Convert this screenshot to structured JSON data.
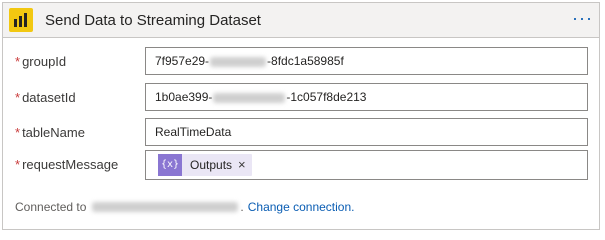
{
  "header": {
    "title": "Send Data to Streaming Dataset",
    "more_label": "···",
    "icon": "power-bi-icon",
    "accent": "#f2c811"
  },
  "fields": [
    {
      "label": "groupId",
      "value_prefix": "7f957e29-",
      "value_suffix": "-8fdc1a58985f"
    },
    {
      "label": "datasetId",
      "value_prefix": "1b0ae399-",
      "value_suffix": "-1c057f8de213"
    },
    {
      "label": "tableName",
      "value": "RealTimeData"
    },
    {
      "label": "requestMessage",
      "token": {
        "icon": "{x}",
        "label": "Outputs",
        "close": "×",
        "color": "#8a76d2"
      }
    }
  ],
  "required_marker": "*",
  "connection": {
    "prefix": "Connected to",
    "suffix": ".",
    "change_label": "Change connection."
  }
}
